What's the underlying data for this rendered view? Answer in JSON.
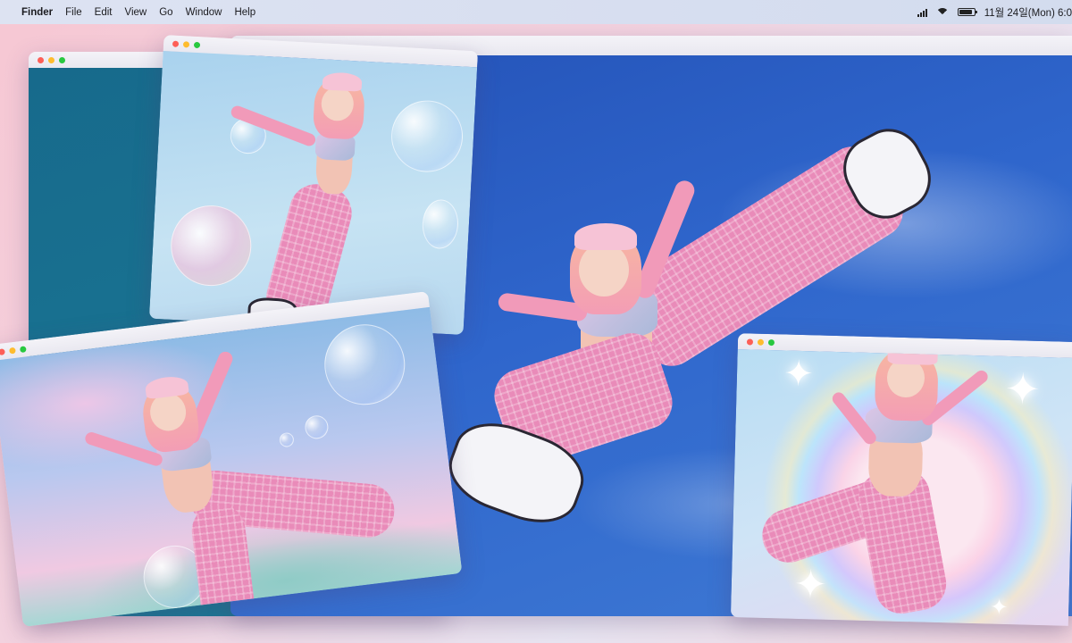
{
  "menubar": {
    "apple_icon": "apple-logo-icon",
    "items": [
      "Finder",
      "File",
      "Edit",
      "View",
      "Go",
      "Window",
      "Help"
    ],
    "clock": "11월 24일(Mon) 6:0"
  },
  "colors": {
    "menubar_bg": "#d9e0f1",
    "sky_blue": "#2f63c9",
    "teal_window": "#1a6f8e",
    "pants_pink": "#e98bb9",
    "close": "#fd5f57",
    "minimize": "#febc2e",
    "zoom": "#28c840"
  },
  "windows": [
    {
      "name": "teal-window"
    },
    {
      "name": "sky-main-window"
    },
    {
      "name": "bubble-window-top"
    },
    {
      "name": "bubble-window-left"
    },
    {
      "name": "rainbow-window-right"
    }
  ]
}
